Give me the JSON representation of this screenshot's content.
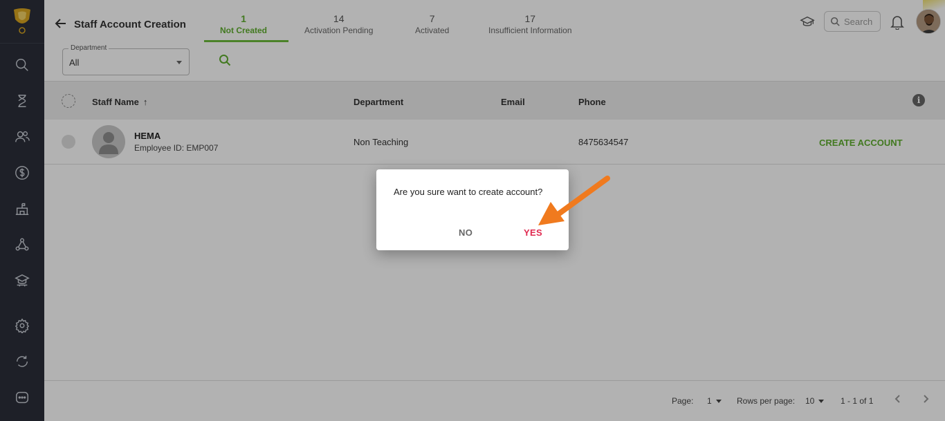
{
  "header": {
    "title": "Staff Account Creation",
    "search_placeholder": "Search"
  },
  "tabs": [
    {
      "count": "1",
      "label": "Not Created",
      "active": true
    },
    {
      "count": "14",
      "label": "Activation Pending",
      "active": false
    },
    {
      "count": "7",
      "label": "Activated",
      "active": false
    },
    {
      "count": "17",
      "label": "Insufficient Information",
      "active": false
    }
  ],
  "filter": {
    "label": "Department",
    "value": "All"
  },
  "table": {
    "columns": [
      "Staff Name",
      "Department",
      "Email",
      "Phone"
    ],
    "rows": [
      {
        "name": "HEMA",
        "employee_id": "Employee ID: EMP007",
        "department": "Non Teaching",
        "email": "",
        "phone": "8475634547",
        "action": "CREATE ACCOUNT"
      }
    ]
  },
  "footer": {
    "page_label": "Page:",
    "page_value": "1",
    "rows_label": "Rows per page:",
    "rows_value": "10",
    "range": "1 - 1 of 1"
  },
  "dialog": {
    "message": "Are you sure want to create account?",
    "no_label": "NO",
    "yes_label": "YES"
  },
  "colors": {
    "accent_green": "#5fae2e",
    "sidebar_bg": "#2b2f3a",
    "yes_red": "#e02a50",
    "annotation_arrow": "#f07a1e"
  }
}
